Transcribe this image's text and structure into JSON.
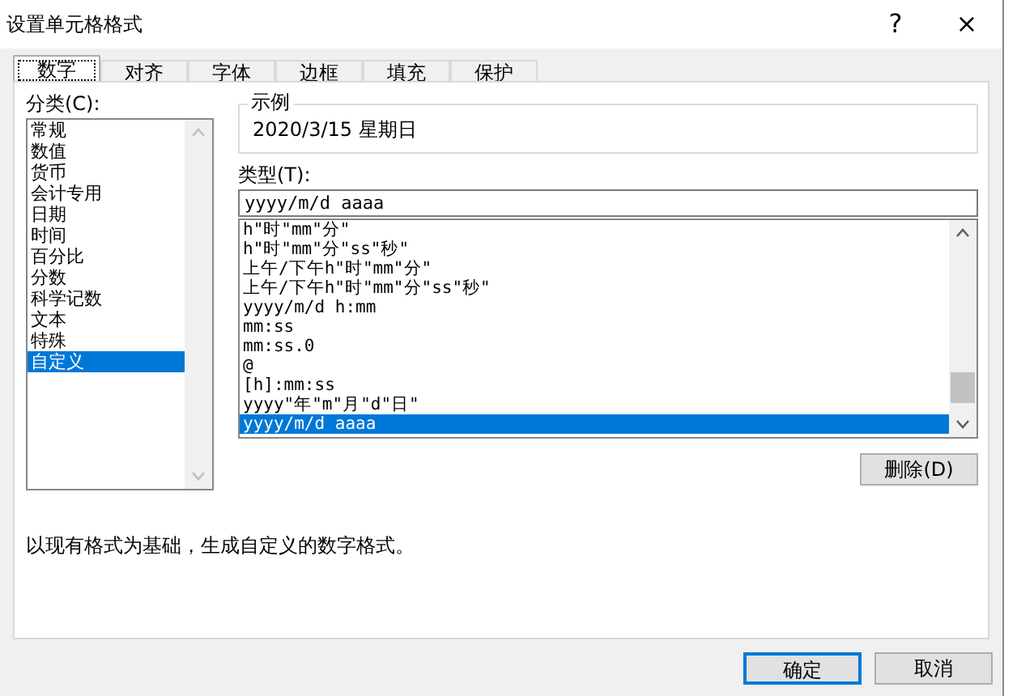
{
  "window": {
    "title": "设置单元格格式",
    "help": "?",
    "close": "×"
  },
  "tabs": [
    {
      "label": "数字",
      "selected": true
    },
    {
      "label": "对齐",
      "selected": false
    },
    {
      "label": "字体",
      "selected": false
    },
    {
      "label": "边框",
      "selected": false
    },
    {
      "label": "填充",
      "selected": false
    },
    {
      "label": "保护",
      "selected": false
    }
  ],
  "category": {
    "label": "分类(C):",
    "items": [
      {
        "label": "常规",
        "selected": false
      },
      {
        "label": "数值",
        "selected": false
      },
      {
        "label": "货币",
        "selected": false
      },
      {
        "label": "会计专用",
        "selected": false
      },
      {
        "label": "日期",
        "selected": false
      },
      {
        "label": "时间",
        "selected": false
      },
      {
        "label": "百分比",
        "selected": false
      },
      {
        "label": "分数",
        "selected": false
      },
      {
        "label": "科学记数",
        "selected": false
      },
      {
        "label": "文本",
        "selected": false
      },
      {
        "label": "特殊",
        "selected": false
      },
      {
        "label": "自定义",
        "selected": true
      }
    ]
  },
  "sample": {
    "label": "示例",
    "value": "2020/3/15  星期日"
  },
  "type": {
    "label": "类型(T):",
    "value": "yyyy/m/d aaaa",
    "items": [
      {
        "label": "h\"时\"mm\"分\"",
        "selected": false
      },
      {
        "label": "h\"时\"mm\"分\"ss\"秒\"",
        "selected": false
      },
      {
        "label": "上午/下午h\"时\"mm\"分\"",
        "selected": false
      },
      {
        "label": "上午/下午h\"时\"mm\"分\"ss\"秒\"",
        "selected": false
      },
      {
        "label": "yyyy/m/d h:mm",
        "selected": false
      },
      {
        "label": "mm:ss",
        "selected": false
      },
      {
        "label": "mm:ss.0",
        "selected": false
      },
      {
        "label": "@",
        "selected": false
      },
      {
        "label": "[h]:mm:ss",
        "selected": false
      },
      {
        "label": "yyyy\"年\"m\"月\"d\"日\"",
        "selected": false
      },
      {
        "label": "yyyy/m/d aaaa",
        "selected": true
      }
    ]
  },
  "delete_button": "删除(D)",
  "description": "以现有格式为基础，生成自定义的数字格式。",
  "buttons": [
    {
      "label": "确定",
      "kind": "default"
    },
    {
      "label": "取消",
      "kind": "normal"
    }
  ]
}
